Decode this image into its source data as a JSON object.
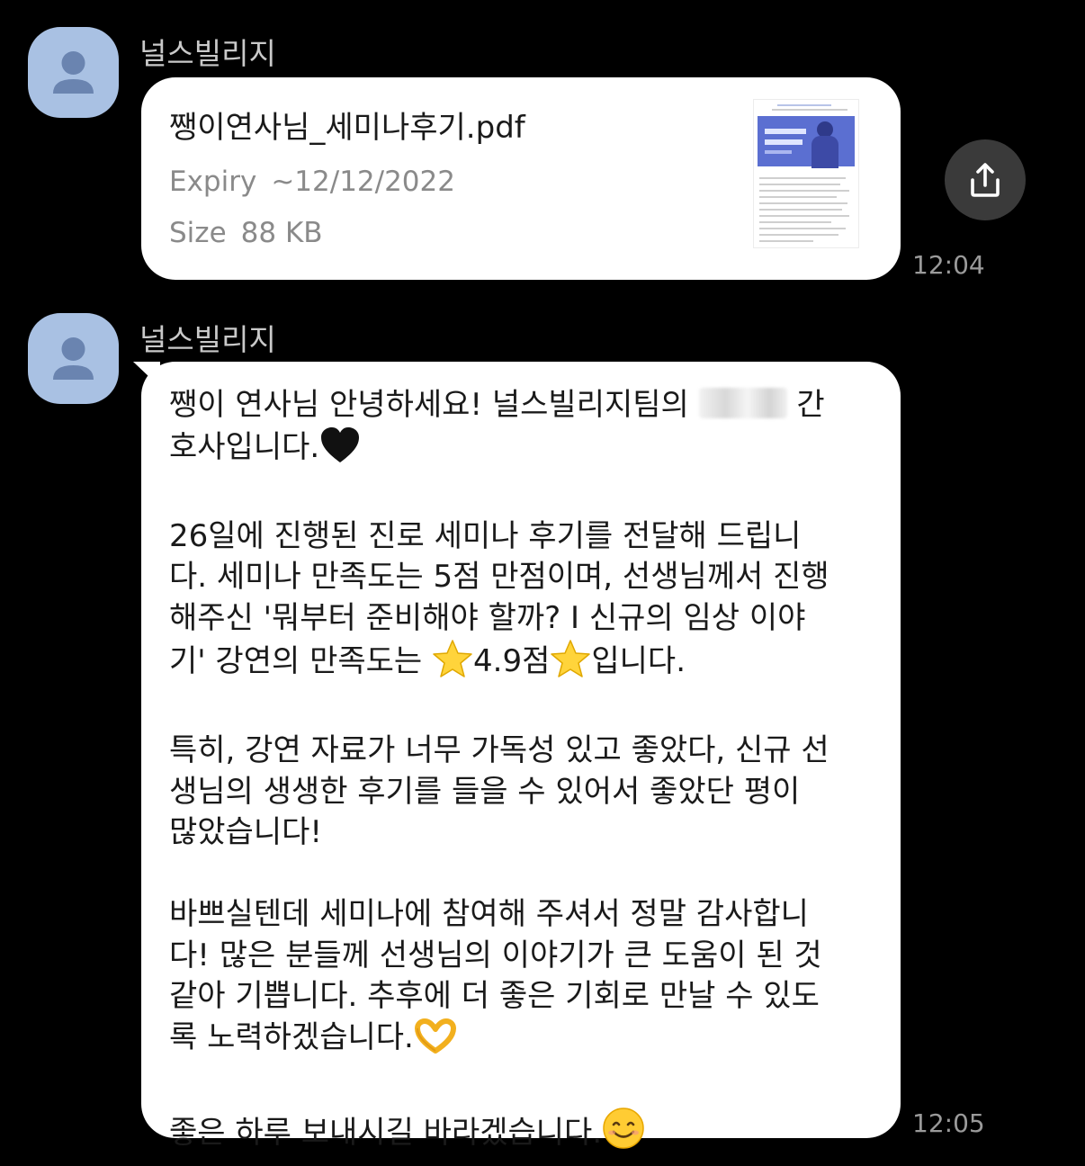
{
  "messages": [
    {
      "sender": "널스빌리지",
      "time": "12:04",
      "file": {
        "name": "쨍이연사님_세미나후기.pdf",
        "expiry_label": "Expiry",
        "expiry_value": "~12/12/2022",
        "size_label": "Size",
        "size_value": "88 KB"
      }
    },
    {
      "sender": "널스빌리지",
      "time": "12:05",
      "lines": {
        "l1a": "쨍이 연사님 안녕하세요! 널스빌리지팀의 ",
        "l1b": " 간",
        "l2": "호사입니다.",
        "l3": "26일에 진행된 진로 세미나 후기를 전달해 드립니",
        "l4": "다. 세미나 만족도는 5점 만점이며, 선생님께서 진행",
        "l5": "해주신 '뭐부터 준비해야 할까? I 신규의 임상 이야",
        "l6a": "기' 강연의 만족도는 ",
        "l6b": "4.9점",
        "l6c": "입니다.",
        "l7": "특히, 강연 자료가 너무 가독성 있고 좋았다, 신규 선",
        "l8": "생님의 생생한 후기를 들을 수 있어서 좋았단 평이",
        "l9": "많았습니다!",
        "l10": "바쁘실텐데 세미나에 참여해 주셔서 정말 감사합니",
        "l11": "다! 많은 분들께 선생님의 이야기가 큰 도움이 된 것",
        "l12": "같아 기쁩니다. 추후에 더 좋은 기회로 만날 수 있도",
        "l13": "록 노력하겠습니다.",
        "l14": "좋은 하루 보내시길 바라겠습니다."
      }
    }
  ],
  "icons": {
    "avatar": "person-icon",
    "share": "share-icon",
    "emojis": [
      "black-heart-icon",
      "star-icon",
      "heart-hands-icon",
      "smiling-face-icon"
    ]
  },
  "colors": {
    "background": "#000000",
    "bubble": "#ffffff",
    "avatar_bg": "#a9c1e3",
    "avatar_fg": "#6a84b0",
    "meta_text": "#8a8a8a"
  }
}
